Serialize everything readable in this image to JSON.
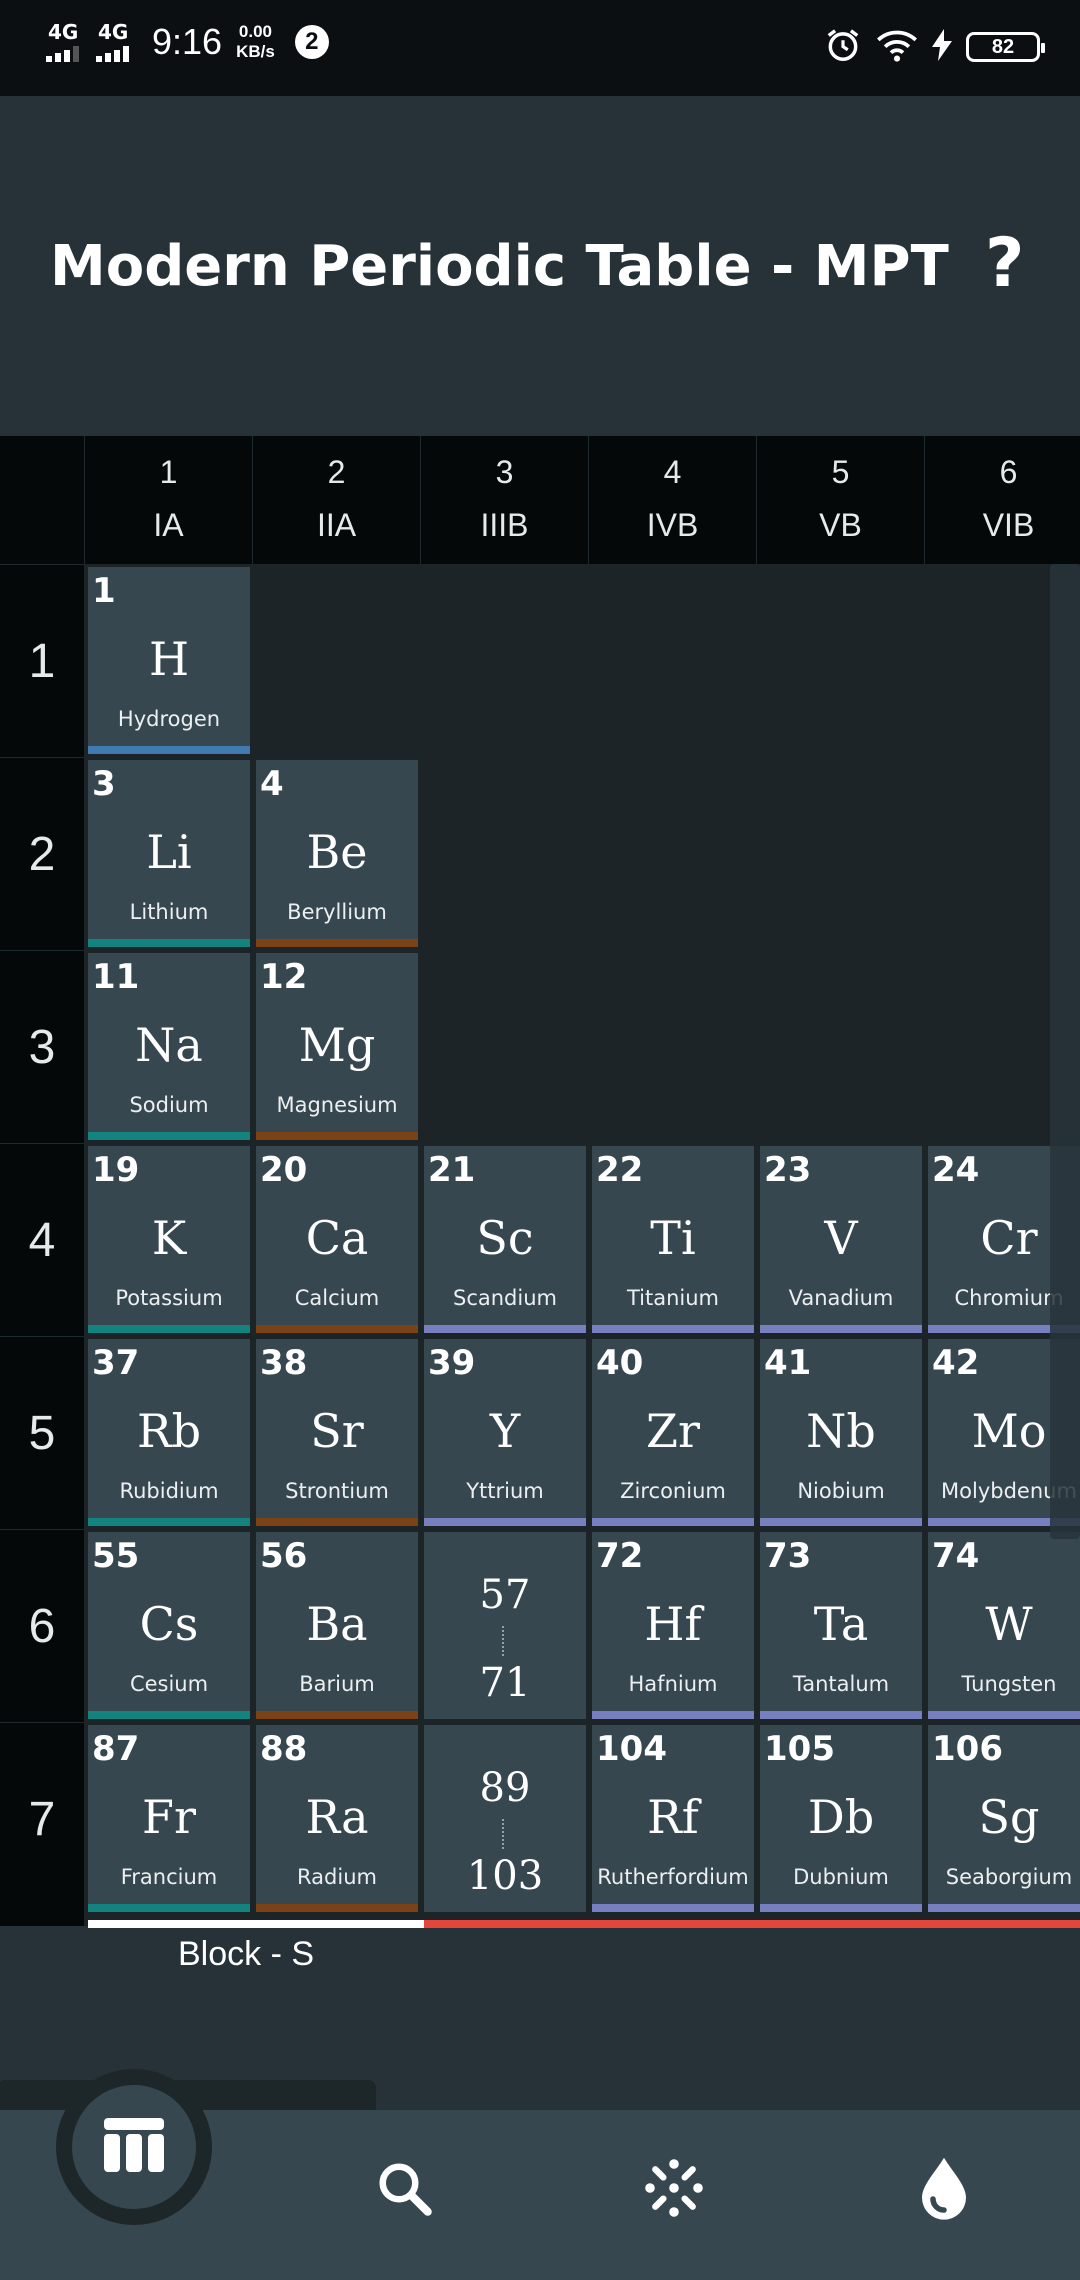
{
  "status_bar": {
    "network1": "4G",
    "network2": "4G",
    "time": "9:16",
    "speed_value": "0.00",
    "speed_unit": "KB/s",
    "notification_count": "2",
    "battery": "82",
    "icons": [
      "alarm-icon",
      "wifi-icon",
      "charging-icon",
      "battery-icon"
    ]
  },
  "app_bar": {
    "title": "Modern Periodic Table - MPT",
    "help_label": "?"
  },
  "groups": [
    {
      "number": "1",
      "roman": "IA"
    },
    {
      "number": "2",
      "roman": "IIA"
    },
    {
      "number": "3",
      "roman": "IIIB"
    },
    {
      "number": "4",
      "roman": "IVB"
    },
    {
      "number": "5",
      "roman": "VB"
    },
    {
      "number": "6",
      "roman": "VIB"
    }
  ],
  "periods": [
    "1",
    "2",
    "3",
    "4",
    "5",
    "6",
    "7"
  ],
  "category_colors": {
    "nonmetal": "#3f7bb0",
    "alkali": "#13837f",
    "alkaline_earth": "#7a4215",
    "transition": "#7680c0"
  },
  "elements": [
    {
      "number": "1",
      "symbol": "H",
      "name": "Hydrogen",
      "period": 1,
      "group": 1,
      "category": "nonmetal"
    },
    {
      "number": "3",
      "symbol": "Li",
      "name": "Lithium",
      "period": 2,
      "group": 1,
      "category": "alkali"
    },
    {
      "number": "4",
      "symbol": "Be",
      "name": "Beryllium",
      "period": 2,
      "group": 2,
      "category": "alkaline_earth"
    },
    {
      "number": "11",
      "symbol": "Na",
      "name": "Sodium",
      "period": 3,
      "group": 1,
      "category": "alkali"
    },
    {
      "number": "12",
      "symbol": "Mg",
      "name": "Magnesium",
      "period": 3,
      "group": 2,
      "category": "alkaline_earth"
    },
    {
      "number": "19",
      "symbol": "K",
      "name": "Potassium",
      "period": 4,
      "group": 1,
      "category": "alkali"
    },
    {
      "number": "20",
      "symbol": "Ca",
      "name": "Calcium",
      "period": 4,
      "group": 2,
      "category": "alkaline_earth"
    },
    {
      "number": "21",
      "symbol": "Sc",
      "name": "Scandium",
      "period": 4,
      "group": 3,
      "category": "transition"
    },
    {
      "number": "22",
      "symbol": "Ti",
      "name": "Titanium",
      "period": 4,
      "group": 4,
      "category": "transition"
    },
    {
      "number": "23",
      "symbol": "V",
      "name": "Vanadium",
      "period": 4,
      "group": 5,
      "category": "transition"
    },
    {
      "number": "24",
      "symbol": "Cr",
      "name": "Chromium",
      "period": 4,
      "group": 6,
      "category": "transition"
    },
    {
      "number": "37",
      "symbol": "Rb",
      "name": "Rubidium",
      "period": 5,
      "group": 1,
      "category": "alkali"
    },
    {
      "number": "38",
      "symbol": "Sr",
      "name": "Strontium",
      "period": 5,
      "group": 2,
      "category": "alkaline_earth"
    },
    {
      "number": "39",
      "symbol": "Y",
      "name": "Yttrium",
      "period": 5,
      "group": 3,
      "category": "transition"
    },
    {
      "number": "40",
      "symbol": "Zr",
      "name": "Zirconium",
      "period": 5,
      "group": 4,
      "category": "transition"
    },
    {
      "number": "41",
      "symbol": "Nb",
      "name": "Niobium",
      "period": 5,
      "group": 5,
      "category": "transition"
    },
    {
      "number": "42",
      "symbol": "Mo",
      "name": "Molybdenum",
      "period": 5,
      "group": 6,
      "category": "transition"
    },
    {
      "number": "55",
      "symbol": "Cs",
      "name": "Cesium",
      "period": 6,
      "group": 1,
      "category": "alkali"
    },
    {
      "number": "56",
      "symbol": "Ba",
      "name": "Barium",
      "period": 6,
      "group": 2,
      "category": "alkaline_earth"
    },
    {
      "range": [
        "57",
        "71"
      ],
      "period": 6,
      "group": 3
    },
    {
      "number": "72",
      "symbol": "Hf",
      "name": "Hafnium",
      "period": 6,
      "group": 4,
      "category": "transition"
    },
    {
      "number": "73",
      "symbol": "Ta",
      "name": "Tantalum",
      "period": 6,
      "group": 5,
      "category": "transition"
    },
    {
      "number": "74",
      "symbol": "W",
      "name": "Tungsten",
      "period": 6,
      "group": 6,
      "category": "transition"
    },
    {
      "number": "87",
      "symbol": "Fr",
      "name": "Francium",
      "period": 7,
      "group": 1,
      "category": "alkali"
    },
    {
      "number": "88",
      "symbol": "Ra",
      "name": "Radium",
      "period": 7,
      "group": 2,
      "category": "alkaline_earth"
    },
    {
      "range": [
        "89",
        "103"
      ],
      "period": 7,
      "group": 3
    },
    {
      "number": "104",
      "symbol": "Rf",
      "name": "Rutherfordium",
      "period": 7,
      "group": 4,
      "category": "transition"
    },
    {
      "number": "105",
      "symbol": "Db",
      "name": "Dubnium",
      "period": 7,
      "group": 5,
      "category": "transition"
    },
    {
      "number": "106",
      "symbol": "Sg",
      "name": "Seaborgium",
      "period": 7,
      "group": 6,
      "category": "transition"
    }
  ],
  "block_legend": {
    "label": "Block - S",
    "s_color": "#ffffff",
    "other_color": "#e5463c"
  },
  "bottom_nav": {
    "items": [
      "table-icon",
      "search-icon",
      "atom-icon",
      "drop-icon"
    ],
    "active": "table-icon"
  }
}
